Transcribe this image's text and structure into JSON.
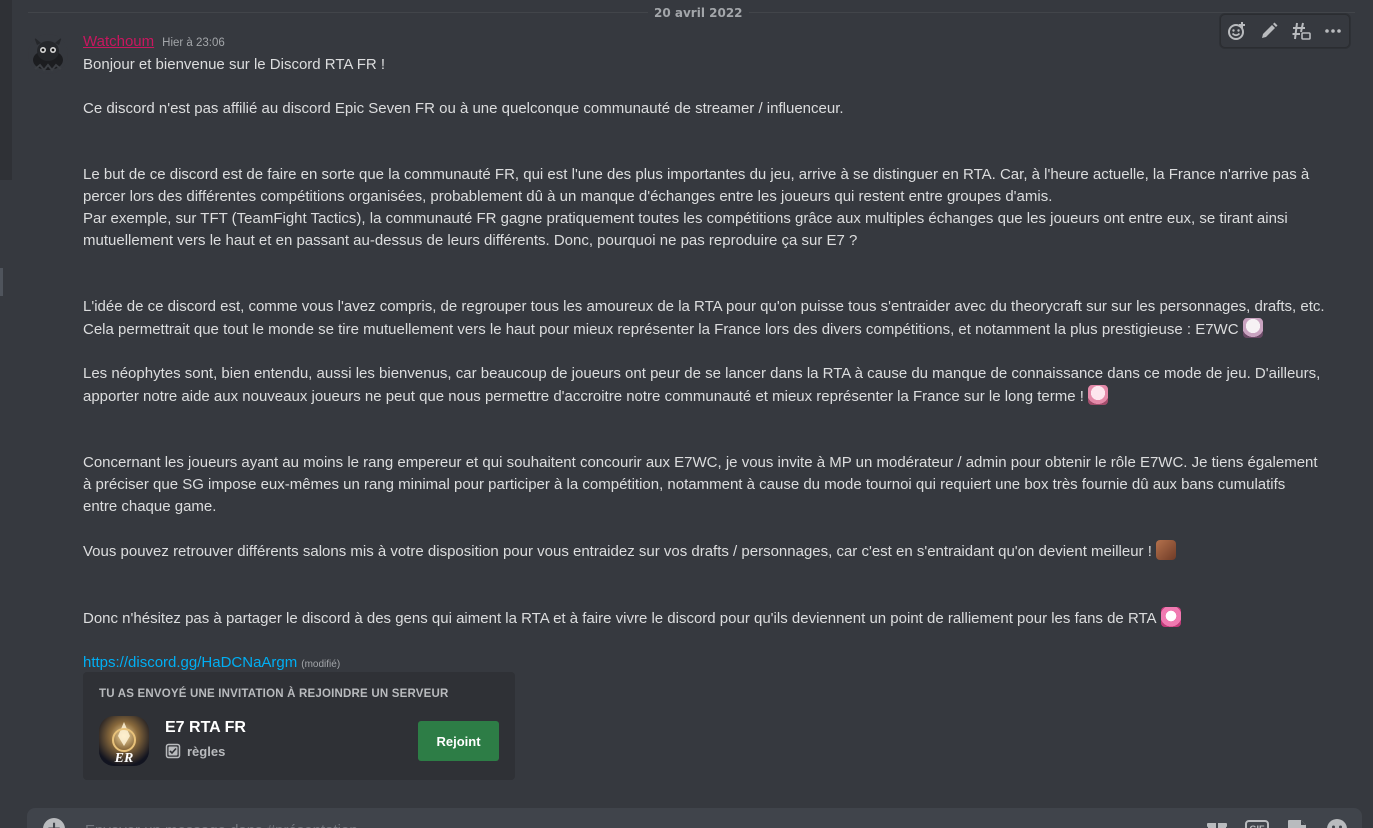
{
  "date_divider": "20 avril 2022",
  "message": {
    "author": "Watchoum",
    "timestamp": "Hier à 23:06",
    "lines": [
      "Bonjour et bienvenue sur le Discord RTA FR !",
      "",
      "Ce discord n'est pas affilié au discord Epic Seven FR ou à une quelconque communauté de streamer / influenceur.",
      "",
      "",
      "Le but de ce discord est de faire en sorte que la communauté FR, qui est l'une des plus importantes du jeu, arrive à se distinguer en RTA. Car, à l'heure actuelle, la France n'arrive pas à",
      "percer lors des différentes compétitions organisées, probablement dû à un manque d'échanges entre les joueurs qui restent entre groupes d'amis.",
      "Par exemple, sur TFT (TeamFight Tactics), la communauté FR gagne pratiquement toutes les compétitions grâce aux multiples échanges que les joueurs ont entre eux, se tirant ainsi",
      "mutuellement vers le haut et en passant au-dessus de leurs différents. Donc, pourquoi ne pas reproduire ça sur E7 ?",
      "",
      "",
      "L'idée de ce discord est, comme vous l'avez compris, de regrouper tous les amoureux de la RTA pour qu'on puisse tous s'entraider avec du theorycraft sur sur les personnages, drafts, etc.",
      "Cela permettrait que tout le monde se tire mutuellement vers le haut pour mieux représenter la France lors des divers compétitions, et notamment la plus prestigieuse : E7WC",
      "",
      "Les néophytes sont, bien entendu, aussi les bienvenus, car beaucoup de joueurs ont peur de se lancer dans la RTA à cause du manque de connaissance dans ce mode de jeu. D'ailleurs,",
      "apporter notre aide aux nouveaux joueurs ne peut que nous permettre d'accroitre notre communauté et mieux représenter la France sur le long terme !",
      "",
      "",
      "Concernant les joueurs ayant au moins le rang empereur et qui souhaitent concourir aux E7WC, je vous invite à MP un modérateur / admin pour obtenir le rôle E7WC. Je tiens également",
      "à préciser que SG impose eux-mêmes un rang minimal pour participer à la compétition, notamment à cause du mode tournoi qui requiert une box très fournie dû aux bans cumulatifs",
      "entre chaque game.",
      "",
      "Vous pouvez retrouver différents salons mis à votre disposition pour vous entraidez sur vos drafts / personnages, car c'est en s'entraidant qu'on devient meilleur !",
      "",
      "",
      "Donc n'hésitez pas à partager le discord à des gens qui aiment la RTA et à faire vivre le discord pour qu'ils deviennent un point de ralliement pour les fans de RTA"
    ],
    "emoji_lines": [
      12,
      15,
      22,
      25
    ],
    "link": "https://discord.gg/HaDCNaArgm",
    "edited_label": "(modifié)"
  },
  "invite": {
    "header": "TU AS ENVOYÉ UNE INVITATION À REJOINDRE UN SERVEUR",
    "guild_name": "E7 RTA FR",
    "guild_icon_text": "ER",
    "channel": "règles",
    "join_label": "Rejoint"
  },
  "composer": {
    "placeholder": "Envoyer un message dans #présentation"
  },
  "colors": {
    "username": "#c8175f",
    "link": "#00aff4",
    "join_button": "#2d7d46",
    "background": "#36393f"
  },
  "icons": {
    "toolbar": [
      "add-reaction-icon",
      "edit-icon",
      "thread-icon",
      "more-icon"
    ],
    "composer": [
      "gift-icon",
      "gif-icon",
      "sticker-icon",
      "emoji-icon"
    ]
  }
}
